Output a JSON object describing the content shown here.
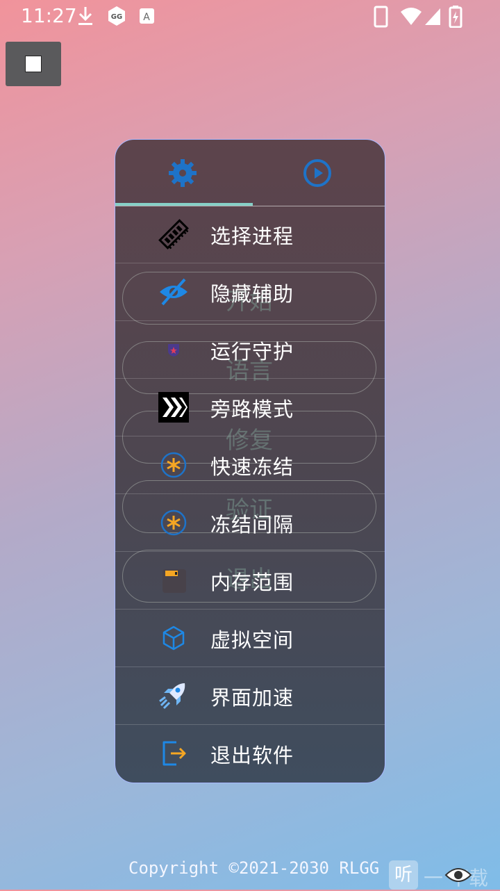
{
  "status_bar": {
    "time": "11:27"
  },
  "tabs": [
    {
      "name": "settings",
      "icon": "gear-icon",
      "active": true
    },
    {
      "name": "start",
      "icon": "play-icon",
      "active": false
    }
  ],
  "ghost_buttons": [
    "开始",
    "语言",
    "修复",
    "验证",
    "退出"
  ],
  "menu": {
    "items": [
      {
        "label": "选择进程",
        "icon": "memory-chip-icon"
      },
      {
        "label": "隐藏辅助",
        "icon": "eye-off-icon"
      },
      {
        "label": "运行守护",
        "icon": "shield-icon"
      },
      {
        "label": "旁路模式",
        "icon": "bypass-chevrons-icon"
      },
      {
        "label": "快速冻结",
        "icon": "snowflake-icon"
      },
      {
        "label": "冻结间隔",
        "icon": "snowflake-icon"
      },
      {
        "label": "内存范围",
        "icon": "memory-card-icon"
      },
      {
        "label": "虚拟空间",
        "icon": "cube-icon"
      },
      {
        "label": "界面加速",
        "icon": "rocket-icon"
      },
      {
        "label": "退出软件",
        "icon": "exit-icon"
      }
    ]
  },
  "footer": {
    "copyright": "Copyright ©2021-2030 RLGG"
  },
  "watermark": {
    "char": "听",
    "text": "一 下载"
  },
  "colors": {
    "accent_teal": "#86d0c7",
    "panel_border": "#a8b8ff",
    "icon_blue": "#1e88e5",
    "icon_orange": "#f5a623"
  }
}
